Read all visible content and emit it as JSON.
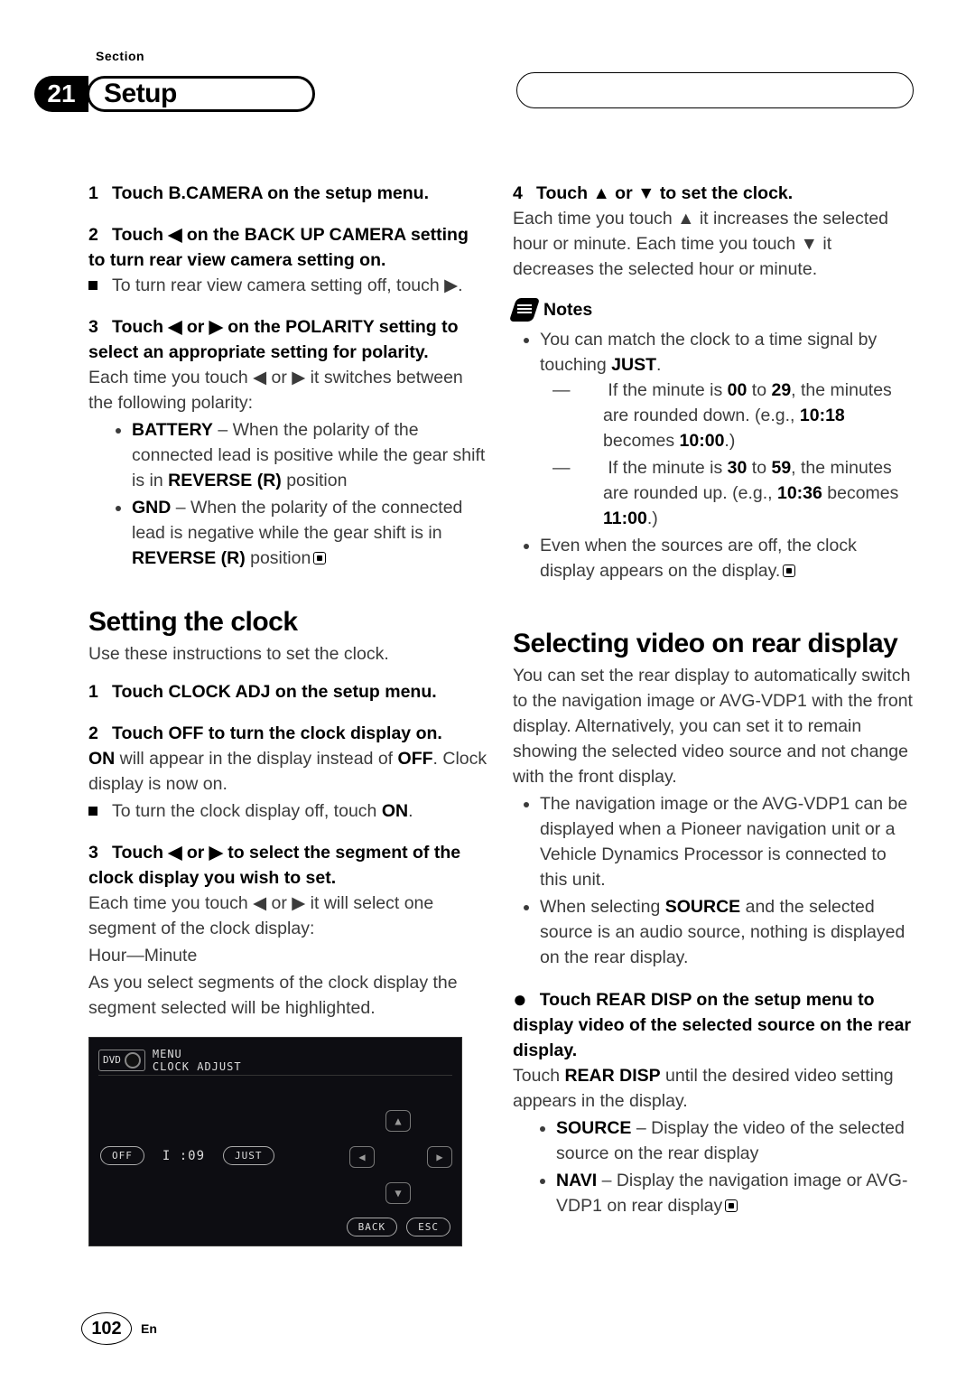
{
  "section_word": "Section",
  "section_number": "21",
  "section_title": "Setup",
  "col_left": {
    "s1": "Touch B.CAMERA on the setup menu.",
    "s2": "Touch ◀ on the BACK UP CAMERA setting to turn rear view camera setting on.",
    "s2_tip": "To turn rear view camera setting off, touch ▶.",
    "s3": "Touch ◀ or ▶ on the POLARITY setting to select an appropriate setting for polarity.",
    "s3_body": "Each time you touch ◀ or ▶ it switches between the following polarity:",
    "s3_b1_lead": "BATTERY",
    "s3_b1_rest": " – When the polarity of the connected lead is positive while the gear shift is in ",
    "s3_b1_bold": "REVERSE (R)",
    "s3_b1_tail": " position",
    "s3_b2_lead": "GND",
    "s3_b2_rest": " – When the polarity of the connected lead is negative while the gear shift is in ",
    "s3_b2_bold": "REVERSE (R)",
    "s3_b2_tail": " position",
    "h_clock": "Setting the clock",
    "clock_intro": "Use these instructions to set the clock.",
    "c1": "Touch CLOCK ADJ on the setup menu.",
    "c2": "Touch OFF to turn the clock display on.",
    "c2_body_on": "ON",
    "c2_body_mid": " will appear in the display instead of ",
    "c2_body_off": "OFF",
    "c2_body_end": ". Clock display is now on.",
    "c2_tip_a": "To turn the clock display off, touch ",
    "c2_tip_b": "ON",
    "c2_tip_c": ".",
    "c3": "Touch ◀ or ▶ to select the segment of the clock display you wish to set.",
    "c3_body1": "Each time you touch ◀ or ▶ it will select one segment of the clock display:",
    "c3_body2": "Hour—Minute",
    "c3_body3": "As you select segments of the clock display the segment selected will be highlighted."
  },
  "col_right": {
    "s4": "Touch ▲ or ▼ to set the clock.",
    "s4_body": "Each time you touch ▲ it increases the selected hour or minute. Each time you touch ▼ it decreases the selected hour or minute.",
    "notes_label": "Notes",
    "n1_a": "You can match the clock to a time signal by touching ",
    "n1_b": "JUST",
    "n1_c": ".",
    "n1_d1_a": "If the minute is ",
    "n1_d1_b": "00",
    "n1_d1_c": " to ",
    "n1_d1_d": "29",
    "n1_d1_e": ", the minutes are rounded down. (e.g., ",
    "n1_d1_f": "10:18",
    "n1_d1_g": " becomes ",
    "n1_d1_h": "10:00",
    "n1_d1_i": ".)",
    "n1_d2_a": "If the minute is ",
    "n1_d2_b": "30",
    "n1_d2_c": " to ",
    "n1_d2_d": "59",
    "n1_d2_e": ", the minutes are rounded up. (e.g., ",
    "n1_d2_f": "10:36",
    "n1_d2_g": " becomes ",
    "n1_d2_h": "11:00",
    "n1_d2_i": ".)",
    "n2": "Even when the sources are off, the clock display appears on the display.",
    "h_rear": "Selecting video on rear display",
    "rear_intro": "You can set the rear display to automatically switch to the navigation image or AVG-VDP1 with the front display. Alternatively, you can set it to remain showing the selected video source and not change with the front display.",
    "rb1": "The navigation image or the AVG-VDP1 can be displayed when a Pioneer navigation unit or a Vehicle Dynamics Processor is connected to this unit.",
    "rb2_a": "When selecting ",
    "rb2_b": "SOURCE",
    "rb2_c": " and the selected source is an audio source, nothing is displayed on the rear display.",
    "r_step": "Touch REAR DISP on the setup menu to display video of the selected source on the rear display.",
    "r_body_a": "Touch ",
    "r_body_b": "REAR DISP",
    "r_body_c": " until the desired video setting appears in the display.",
    "r_opt1_a": "SOURCE",
    "r_opt1_b": " – Display the video of the selected source on the rear display",
    "r_opt2_a": "NAVI",
    "r_opt2_b": " – Display the navigation image or AVG-VDP1 on rear display"
  },
  "screen": {
    "dvd": "DVD",
    "menu": "MENU",
    "clock_adjust": "CLOCK ADJUST",
    "off": "OFF",
    "time": "I :09",
    "just": "JUST",
    "back": "BACK",
    "esc": "ESC"
  },
  "footer": {
    "page": "102",
    "lang": "En"
  }
}
